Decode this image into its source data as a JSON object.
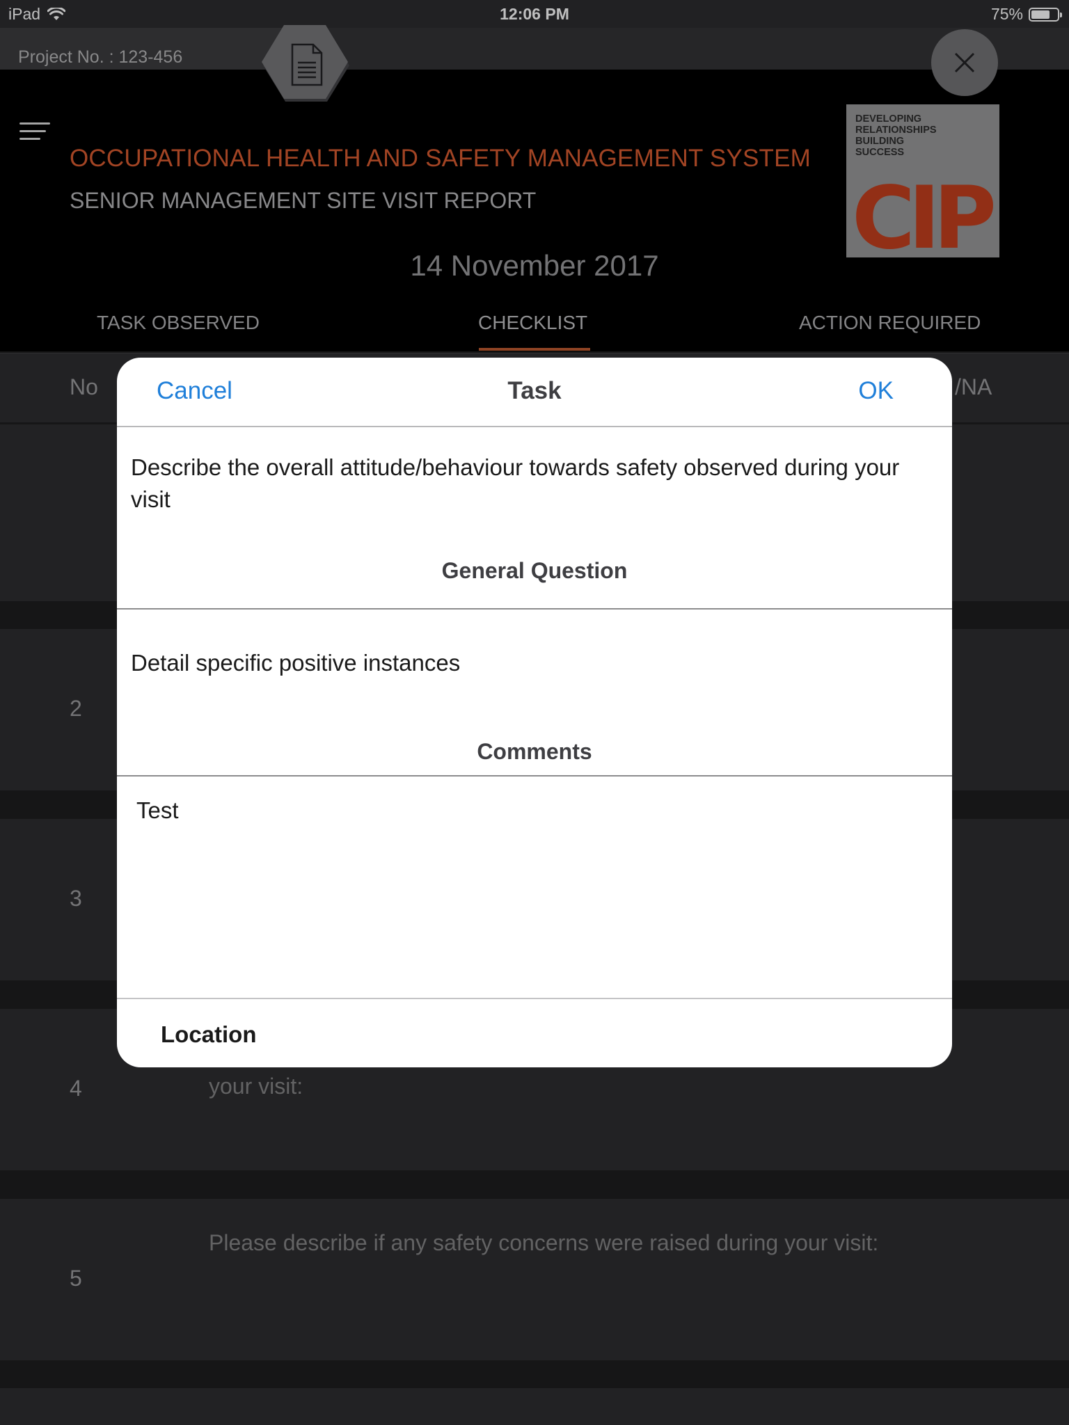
{
  "status_bar": {
    "device": "iPad",
    "time": "12:06 PM",
    "battery": "75%",
    "battery_level": 0.75
  },
  "project": {
    "label": "Project No. : 123-456"
  },
  "header": {
    "title": "OCCUPATIONAL HEALTH AND SAFETY MANAGEMENT SYSTEM",
    "subtitle": "SENIOR MANAGEMENT SITE VISIT REPORT",
    "date": "14 November 2017",
    "logo_tagline": "DEVELOPING\nRELATIONSHIPS\nBUILDING\nSUCCESS",
    "logo_wordmark": "CIP"
  },
  "tabs": {
    "task_observed": "TASK OBSERVED",
    "checklist": "CHECKLIST",
    "action_required": "ACTION REQUIRED"
  },
  "table": {
    "col_no": "No",
    "col_status": "/NA",
    "rows": [
      {
        "no": "",
        "text": ""
      },
      {
        "no": "2",
        "text": ""
      },
      {
        "no": "3",
        "text": ""
      },
      {
        "no": "4",
        "text": "your visit:"
      },
      {
        "no": "5",
        "text": "Please describe if any safety concerns were raised during your visit:"
      }
    ]
  },
  "modal": {
    "cancel_label": "Cancel",
    "title": "Task",
    "ok_label": "OK",
    "question": "Describe the overall attitude/behaviour towards safety observed during your visit",
    "question_type": "General Question",
    "detail": "Detail specific positive instances",
    "comments_label": "Comments",
    "comments_value": "Test",
    "location_label": "Location"
  },
  "colors": {
    "accent": "#c6542c",
    "link": "#1f7fd9",
    "background": "#1b1b1d"
  }
}
